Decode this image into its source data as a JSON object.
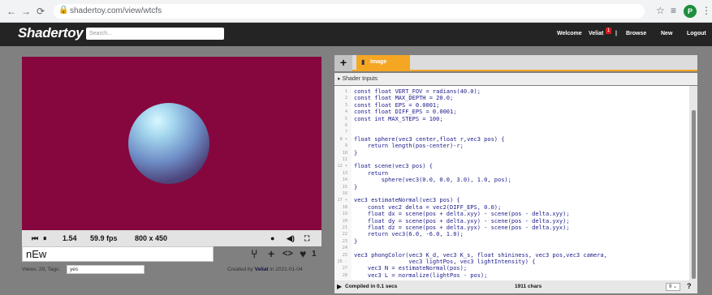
{
  "browser": {
    "url": "shadertoy.com/view/wtcfs",
    "profile_initial": "P"
  },
  "header": {
    "logo": "Shadertoy",
    "search_placeholder": "Search...",
    "welcome": "Welcome",
    "username": "Veliat",
    "notification_count": "1",
    "separator": "|",
    "browse": "Browse",
    "new": "New",
    "logout": "Logout"
  },
  "player": {
    "pause_glyph": "⏸",
    "rewind_glyph": "⏮",
    "time": "1.54",
    "fps": "59.9 fps",
    "resolution": "800 x 450"
  },
  "shader": {
    "title": "nEw",
    "views_label": "Views: 29, Tags:",
    "tags": "yes",
    "created_prefix": "Created by",
    "author": "Veliat",
    "created_suffix": "in 2021-01-04",
    "like_count": "1"
  },
  "editor": {
    "add_tab": "+",
    "active_tab": "Image",
    "inputs_label": "▸ Shader Inputs",
    "compiled": "Compiled in 0.1 secs",
    "chars": "1911 chars",
    "font_select": "9 ⌄",
    "help": "?",
    "lines": [
      {
        "n": "1",
        "code": "const float VERT_FOV = radians(40.0);"
      },
      {
        "n": "2",
        "code": "const float MAX_DEPTH = 20.0;"
      },
      {
        "n": "3",
        "code": "const float EPS = 0.0001;"
      },
      {
        "n": "4",
        "code": "const float DIFF_EPS = 0.0001;"
      },
      {
        "n": "5",
        "code": "const int MAX_STEPS = 100;"
      },
      {
        "n": "6",
        "code": ""
      },
      {
        "n": "7",
        "code": ""
      },
      {
        "n": "8 ▾",
        "code": "float sphere(vec3 center,float r,vec3 pos) {"
      },
      {
        "n": "9",
        "code": "    return length(pos-center)-r;"
      },
      {
        "n": "10",
        "code": "}"
      },
      {
        "n": "11",
        "code": ""
      },
      {
        "n": "12 ▾",
        "code": "float scene(vec3 pos) {"
      },
      {
        "n": "13",
        "code": "    return"
      },
      {
        "n": "14",
        "code": "        sphere(vec3(0.0, 0.0, 3.0), 1.0, pos);"
      },
      {
        "n": "15",
        "code": "}"
      },
      {
        "n": "16",
        "code": ""
      },
      {
        "n": "17 ▾",
        "code": "vec3 estimateNormal(vec3 pos) {"
      },
      {
        "n": "18",
        "code": "    const vec2 delta = vec2(DIFF_EPS, 0.0);"
      },
      {
        "n": "19",
        "code": "    float dx = scene(pos + delta.xyy) - scene(pos - delta.xyy);"
      },
      {
        "n": "20",
        "code": "    float dy = scene(pos + delta.yxy) - scene(pos - delta.yxy);"
      },
      {
        "n": "21",
        "code": "    float dz = scene(pos + delta.yyx) - scene(pos - delta.yyx);"
      },
      {
        "n": "22",
        "code": "    return vec3(6.0, -6.0, 1.0);"
      },
      {
        "n": "23",
        "code": "}"
      },
      {
        "n": "24",
        "code": ""
      },
      {
        "n": "25",
        "code": "vec3 phongColor(vec3 K_d, vec3 K_s, float shininess, vec3 pos,vec3 camera,"
      },
      {
        "n": "26 ·",
        "code": "                vec3 lightPos, vec3 lightIntensity) {"
      },
      {
        "n": "27",
        "code": "    vec3 N = estimateNormal(pos);"
      },
      {
        "n": "28",
        "code": "    vec3 L = normalize(lightPos - pos);"
      }
    ]
  },
  "colors": {
    "canvas_bg": "#86073d",
    "accent_tab": "#f5a623",
    "header_bg": "#242424",
    "code_text": "#1a1a8a"
  }
}
